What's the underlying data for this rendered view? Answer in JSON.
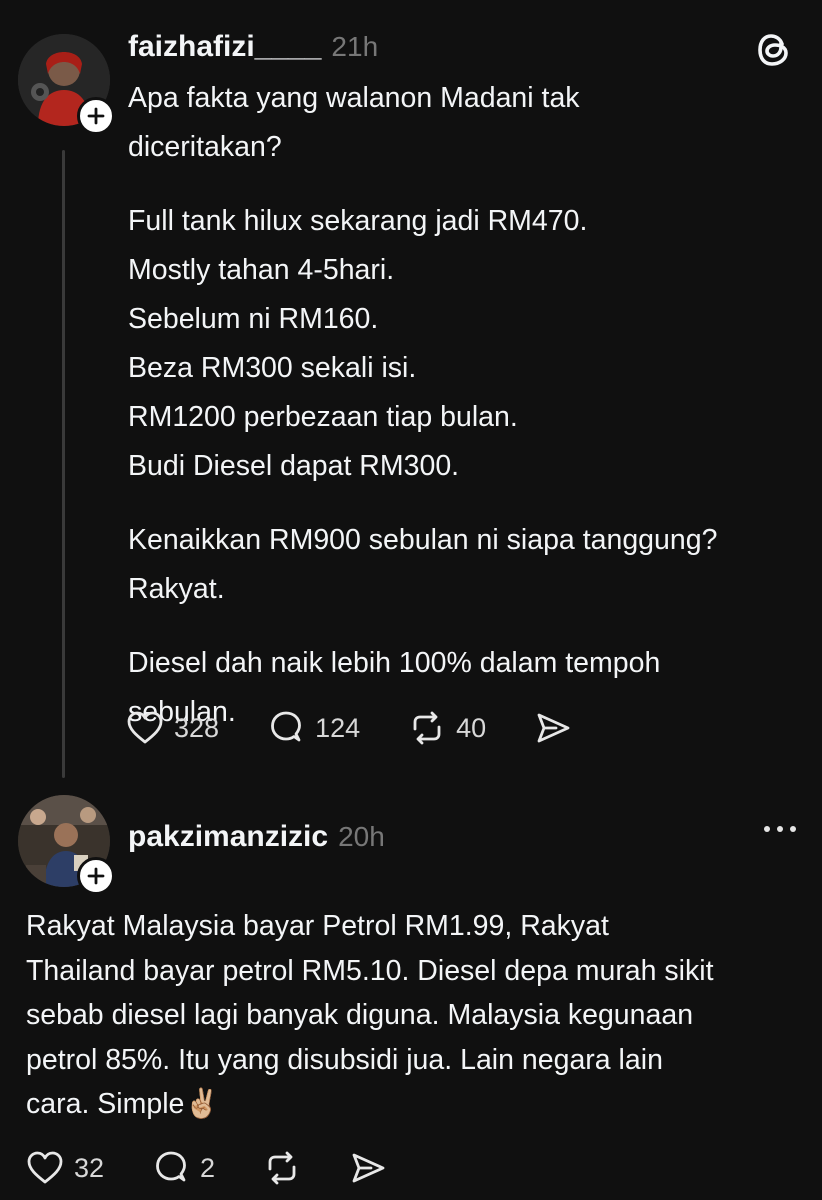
{
  "posts": [
    {
      "username": "faizhafizi____",
      "time": "21h",
      "paragraphs": [
        [
          "Apa fakta  yang walanon Madani tak",
          "diceritakan?"
        ],
        [
          "Full tank hilux sekarang jadi RM470.",
          "Mostly tahan 4-5hari.",
          "Sebelum ni RM160.",
          "Beza RM300 sekali isi.",
          "RM1200 perbezaan tiap bulan.",
          "Budi Diesel dapat RM300."
        ],
        [
          "Kenaikkan RM900 sebulan ni siapa tanggung?",
          "Rakyat."
        ],
        [
          "Diesel dah naik lebih 100% dalam tempoh",
          "sebulan."
        ]
      ],
      "likes": "328",
      "replies": "124",
      "reposts": "40"
    },
    {
      "username": "pakzimanzizic",
      "time": "20h",
      "lines": [
        "Rakyat Malaysia bayar Petrol RM1.99, Rakyat",
        "Thailand bayar petrol RM5.10. Diesel depa murah sikit",
        "sebab diesel lagi banyak diguna. Malaysia kegunaan",
        "petrol 85%. Itu yang disubsidi jua. Lain negara lain",
        "cara. Simple"
      ],
      "emoji": "✌🏼",
      "likes": "32",
      "replies": "2"
    }
  ],
  "icons": {
    "like": "heart-icon",
    "reply": "comment-icon",
    "repost": "repost-icon",
    "share": "send-icon",
    "brand": "threads-logo-icon",
    "more": "more-icon"
  }
}
